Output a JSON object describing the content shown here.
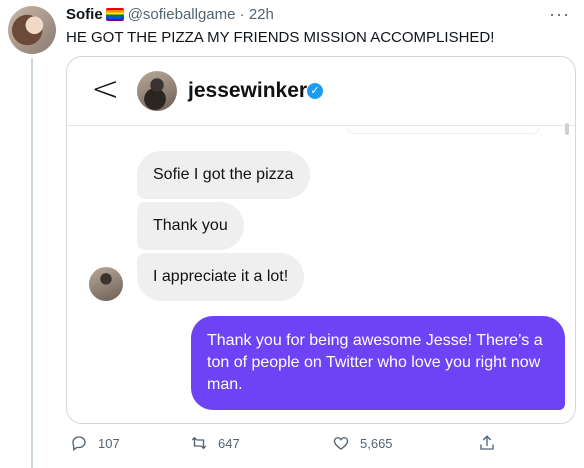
{
  "tweet": {
    "author_name": "Sofie",
    "handle": "@sofieballgame",
    "separator": "·",
    "time": "22h",
    "more": "···",
    "text": "HE GOT THE PIZZA MY FRIENDS MISSION ACCOMPLISHED!",
    "flag_icon": "rainbow-flag-icon"
  },
  "dm": {
    "back": "<",
    "username": "jessewinker",
    "verified_icon": "✓",
    "messages": [
      {
        "from": "other",
        "text": "Sofie I got the pizza"
      },
      {
        "from": "other",
        "text": "Thank you"
      },
      {
        "from": "other",
        "text": "I appreciate it a lot!"
      },
      {
        "from": "me",
        "text": "Thank you for being awesome Jesse! There’s a ton of people on Twitter who love you right now man."
      }
    ],
    "colors": {
      "sent_bubble": "#6e43f5",
      "received_bubble": "#efefef",
      "verified": "#1d9bf0"
    }
  },
  "actions": {
    "replies": "107",
    "retweets": "647",
    "likes": "5,665"
  }
}
